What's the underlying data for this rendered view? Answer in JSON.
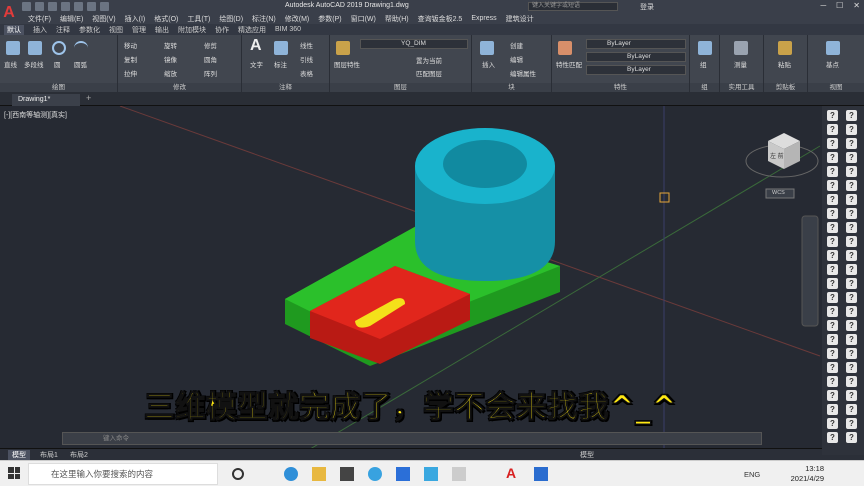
{
  "app": {
    "logo_letter": "A",
    "title": "Autodesk AutoCAD 2019    Drawing1.dwg",
    "search_placeholder": "键入关键字或短语",
    "login": "登录"
  },
  "menubar": [
    "文件(F)",
    "编辑(E)",
    "视图(V)",
    "插入(I)",
    "格式(O)",
    "工具(T)",
    "绘图(D)",
    "标注(N)",
    "修改(M)",
    "参数(P)",
    "窗口(W)",
    "帮助(H)",
    "查询钣金板2.5",
    "Express",
    "建筑设计"
  ],
  "ribbon_tabs": [
    "默认",
    "插入",
    "注释",
    "参数化",
    "视图",
    "管理",
    "输出",
    "附加模块",
    "协作",
    "精选应用",
    "BIM 360"
  ],
  "ribbon": {
    "draw": {
      "label": "绘图",
      "items": [
        "直线",
        "多段线",
        "圆",
        "圆弧"
      ]
    },
    "modify": {
      "label": "修改",
      "items": [
        "移动",
        "旋转",
        "修剪",
        "复制",
        "镜像",
        "圆角",
        "拉伸",
        "缩放",
        "阵列"
      ]
    },
    "annotation": {
      "label": "注释",
      "items": [
        "文字",
        "标注",
        "线性",
        "引线",
        "表格"
      ]
    },
    "layers": {
      "label": "图层",
      "layer_name": "YQ_DIM",
      "items": [
        "图层特性",
        "置为当前",
        "匹配图层"
      ]
    },
    "block": {
      "label": "块",
      "items": [
        "插入",
        "创建",
        "编辑",
        "编辑属性"
      ]
    },
    "properties": {
      "label": "特性",
      "bylayer1": "ByLayer",
      "bylayer2": "ByLayer",
      "bylayer3": "ByLayer",
      "match": "特性匹配"
    },
    "groups": {
      "label": "组",
      "item": "组"
    },
    "utilities": {
      "label": "实用工具",
      "item": "测量"
    },
    "clipboard": {
      "label": "剪贴板",
      "item": "粘贴"
    },
    "view": {
      "label": "视图",
      "item": "基点"
    }
  },
  "doc_tab": "Drawing1*",
  "viewport_label": "[-][西南等轴测][真实]",
  "viewcube": {
    "face": "左 前",
    "sub": "WCS"
  },
  "command_placeholder": "键入命令",
  "layout_tabs": [
    "模型",
    "布局1",
    "布局2"
  ],
  "status": {
    "model": "模型"
  },
  "subtitle": "三维模型就完成了，学不会来找我^_^",
  "taskbar": {
    "search": "在这里输入你要搜索的内容",
    "time": "13:18",
    "date": "2021/4/29",
    "lang": "ENG"
  },
  "colors": {
    "cyan": "#19a7bf",
    "green": "#21b521",
    "red": "#e1261c",
    "yellow": "#f4e01a"
  }
}
